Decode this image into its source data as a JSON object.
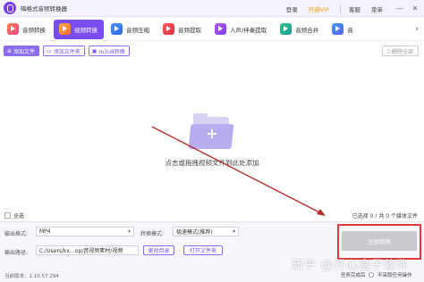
{
  "titlebar": {
    "app_title": "嗨格式音频转换器",
    "login": "登录",
    "vip": "开通VIP",
    "service": "客服",
    "menu": "菜单",
    "minimize": "—",
    "close": "✕"
  },
  "tools": [
    {
      "label": "音频转换",
      "icon": "audio-convert-icon"
    },
    {
      "label": "视频转换",
      "icon": "video-convert-icon",
      "active": true
    },
    {
      "label": "音频压缩",
      "icon": "audio-compress-icon"
    },
    {
      "label": "音频提取",
      "icon": "audio-extract-icon"
    },
    {
      "label": "人声/伴奏提取",
      "icon": "vocal-extract-icon"
    },
    {
      "label": "音频合并",
      "icon": "audio-merge-icon"
    },
    {
      "label": "音",
      "icon": "audio-cut-icon"
    }
  ],
  "tools_more": "›",
  "actions": {
    "add_file": "添加文件",
    "add_folder": "添加文件夹",
    "m3u8": "m3u8转换",
    "delete_all": "删除全部"
  },
  "dropzone": {
    "text": "点击或拖拽视频文件到此处添加"
  },
  "selection": {
    "select_all": "全选",
    "count_text": "已选择 0 / 共 0 个媒体文件"
  },
  "output": {
    "format_label": "输出格式:",
    "format_value": "MP4",
    "mode_label": "转换模式:",
    "mode_value": "极速模式(推荐)",
    "path_label": "输出路径:",
    "path_value": "C:/Users/kx...op/音视频素材/视频",
    "change_dir": "更改目录",
    "open_folder": "打开文件夹",
    "convert_all": "全部转换",
    "version": "当前版本：1.10.57.294",
    "task_done_label": "任务完成后",
    "task_done_option": "不采取任何操作"
  },
  "watermark": "知乎 @开心盒子软件",
  "colors": {
    "accent": "#7b4cf0",
    "highlight": "#e03a3a",
    "disabled_button": "#c9c9cf"
  }
}
